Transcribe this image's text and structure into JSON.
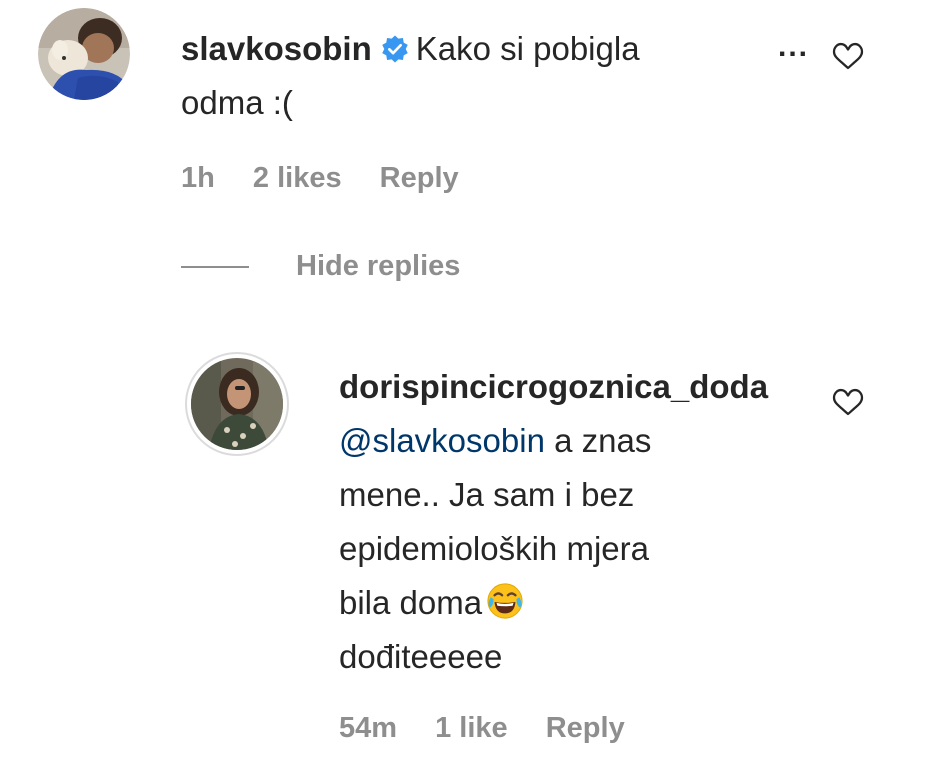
{
  "comment": {
    "username": "slavkosobin",
    "verified": true,
    "text_line1": "Kako si pobigla",
    "text_line2": "odma :(",
    "more_label": "...",
    "time": "1h",
    "likes": "2 likes",
    "reply_label": "Reply",
    "avatar_icon": "profile-photo-man-with-dog"
  },
  "thread": {
    "hide_replies_label": "Hide replies"
  },
  "reply": {
    "username": "dorispincicrogoznica_doda",
    "mention": "@slavkosobin",
    "text_after_mention": " a znas",
    "line2": "mene.. Ja sam i bez",
    "line3": "epidemioloških mjera",
    "line4": "bila doma",
    "emoji_icon": "face-with-tears-of-joy-icon",
    "line5": "dođiteeeee",
    "time": "54m",
    "likes": "1 like",
    "reply_label": "Reply",
    "avatar_icon": "profile-photo-woman"
  },
  "colors": {
    "text": "#262626",
    "secondary": "#8e8e8e",
    "mention": "#00376b",
    "verified": "#3897f0"
  }
}
